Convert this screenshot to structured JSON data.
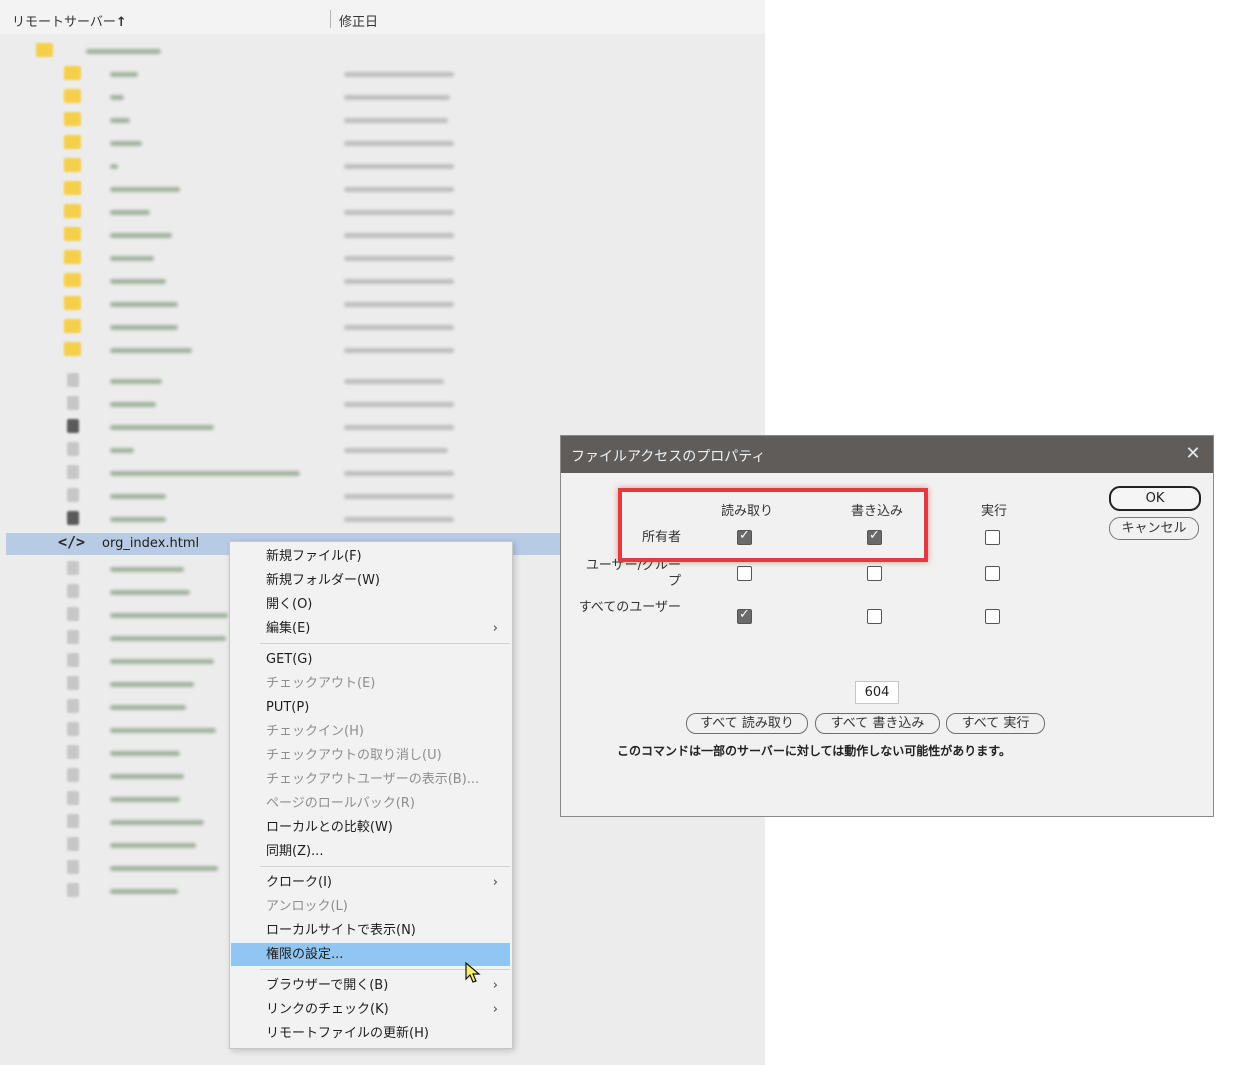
{
  "file_panel": {
    "columns": {
      "name": "リモートサーバー",
      "name_sort_arrow": "↑",
      "modified": "修正日"
    },
    "selected_file": "org_index.html"
  },
  "context_menu": {
    "items": [
      {
        "label": "新規ファイル(F)"
      },
      {
        "label": "新規フォルダー(W)"
      },
      {
        "label": "開く(O)"
      },
      {
        "label": "編集(E)",
        "submenu": "›"
      },
      {
        "label": "GET(G)"
      },
      {
        "label": "チェックアウト(E)"
      },
      {
        "label": "PUT(P)"
      },
      {
        "label": "チェックイン(H)"
      },
      {
        "label": "チェックアウトの取り消し(U)"
      },
      {
        "label": "チェックアウトユーザーの表示(B)..."
      },
      {
        "label": "ページのロールバック(R)"
      },
      {
        "label": "ローカルとの比較(W)"
      },
      {
        "label": "同期(Z)..."
      },
      {
        "label": "クローク(I)",
        "submenu": "›"
      },
      {
        "label": "アンロック(L)"
      },
      {
        "label": "ローカルサイトで表示(N)"
      },
      {
        "label": "権限の設定..."
      },
      {
        "label": "ブラウザーで開く(B)",
        "submenu": "›"
      },
      {
        "label": "リンクのチェック(K)",
        "submenu": "›"
      },
      {
        "label": "リモートファイルの更新(H)"
      }
    ]
  },
  "dialog": {
    "title": "ファイルアクセスのプロパティ",
    "close": "✕",
    "columns": {
      "read": "読み取り",
      "write": "書き込み",
      "execute": "実行"
    },
    "rows": {
      "owner": "所有者",
      "group": "ユーザー/グループ",
      "all": "すべてのユーザー"
    },
    "octal_value": "604",
    "buttons": {
      "all_read": "すべて 読み取り",
      "all_write": "すべて 書き込み",
      "all_execute": "すべて 実行",
      "ok": "OK",
      "cancel": "キャンセル"
    },
    "warning": "このコマンドは一部のサーバーに対しては動作しない可能性があります。"
  },
  "colors": {
    "selection": "#b8cbe5",
    "menu_highlight": "#92c6f2",
    "dialog_title_bar": "#5f5c5a",
    "annotation_box": "#e23a3f",
    "folder": "#f6cf4a"
  }
}
